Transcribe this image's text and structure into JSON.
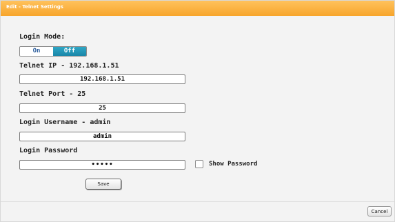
{
  "dialog": {
    "title": "Edit - Telnet Settings"
  },
  "login_mode": {
    "label": "Login Mode:",
    "on_label": "On",
    "off_label": "Off",
    "selected": "Off"
  },
  "telnet_ip": {
    "label": "Telnet IP - 192.168.1.51",
    "value": "192.168.1.51"
  },
  "telnet_port": {
    "label": "Telnet Port - 25",
    "value": "25"
  },
  "login_username": {
    "label": "Login Username - admin",
    "value": "admin"
  },
  "login_password": {
    "label": "Login Password",
    "value": "admin",
    "show_label": "Show Password"
  },
  "buttons": {
    "save": "Save",
    "cancel": "Cancel"
  },
  "colors": {
    "title_bar": "#f7a52c",
    "toggle_active": "#1a86a8"
  }
}
